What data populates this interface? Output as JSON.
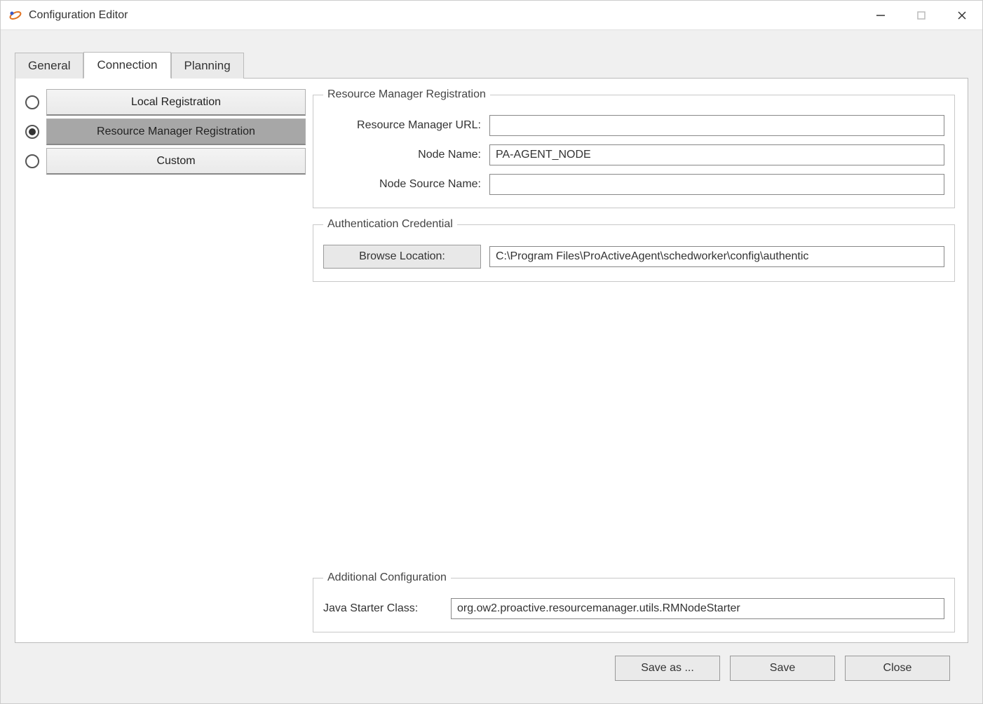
{
  "window": {
    "title": "Configuration Editor"
  },
  "tabs": {
    "general": "General",
    "connection": "Connection",
    "planning": "Planning"
  },
  "connection_options": {
    "local": "Local Registration",
    "rm": "Resource Manager Registration",
    "custom": "Custom",
    "selected": "rm"
  },
  "rm_group": {
    "legend": "Resource Manager Registration",
    "url_label": "Resource Manager URL:",
    "url_value": "",
    "node_name_label": "Node Name:",
    "node_name_value": "PA-AGENT_NODE",
    "node_source_label": "Node Source Name:",
    "node_source_value": ""
  },
  "auth_group": {
    "legend": "Authentication Credential",
    "browse_label": "Browse Location:",
    "path_value": "C:\\Program Files\\ProActiveAgent\\schedworker\\config\\authentic"
  },
  "additional_group": {
    "legend": "Additional Configuration",
    "starter_label": "Java Starter Class:",
    "starter_value": "org.ow2.proactive.resourcemanager.utils.RMNodeStarter"
  },
  "buttons": {
    "save_as": "Save as ...",
    "save": "Save",
    "close": "Close"
  }
}
